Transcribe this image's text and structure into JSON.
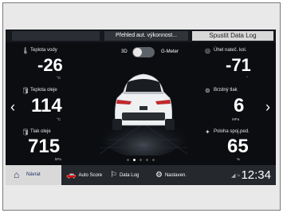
{
  "tabs": {
    "left": "",
    "middle": "Přehled aut. výkonnost...",
    "right": "Spustit Data Log"
  },
  "toggle": {
    "left_label": "3D",
    "right_label": "G-Meter"
  },
  "gauges": {
    "water_temp": {
      "label": "Teplota vody",
      "value": "-26",
      "unit": "°C"
    },
    "oil_temp": {
      "label": "Teplota oleje",
      "value": "114",
      "unit": "°C"
    },
    "oil_pressure": {
      "label": "Tlak oleje",
      "value": "715",
      "unit": "kPa"
    },
    "intake_temp": {
      "label": "Úhel nateč. kol.",
      "value": "-71",
      "unit": "°"
    },
    "brake_pressure": {
      "label": "Brzdný tlak",
      "value": "6",
      "unit": "MPa"
    },
    "throttle": {
      "label": "Poloha spoj.ped.",
      "value": "65",
      "unit": "%"
    }
  },
  "pager": {
    "count": 5,
    "active": 1
  },
  "bottom_nav": {
    "home": "Návrat",
    "auto_score": "Auto Score",
    "data_log": "Data Log",
    "settings": "Nastaven."
  },
  "clock": "12:34"
}
